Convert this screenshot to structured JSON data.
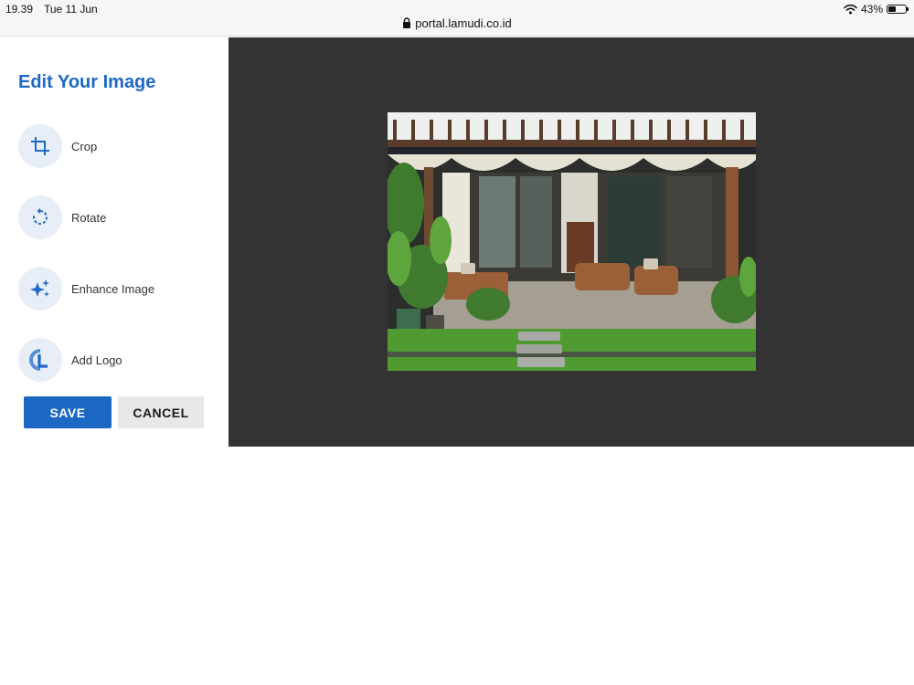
{
  "status_bar": {
    "time": "19.39",
    "date": "Tue 11 Jun",
    "url": "portal.lamudi.co.id",
    "battery_text": "43%",
    "battery_level": 0.43,
    "lock_icon": "lock-icon",
    "wifi_icon": "wifi-icon"
  },
  "editor": {
    "title": "Edit Your Image",
    "tools": [
      {
        "label": "Crop",
        "icon": "crop-icon"
      },
      {
        "label": "Rotate",
        "icon": "rotate-icon"
      },
      {
        "label": "Enhance Image",
        "icon": "sparkle-icon"
      },
      {
        "label": "Add Logo",
        "icon": "logo-icon"
      }
    ],
    "save_label": "SAVE",
    "cancel_label": "CANCEL"
  },
  "colors": {
    "accent": "#1c69c7",
    "canvas_bg": "#333333",
    "icon_bg": "#e8eef7"
  }
}
